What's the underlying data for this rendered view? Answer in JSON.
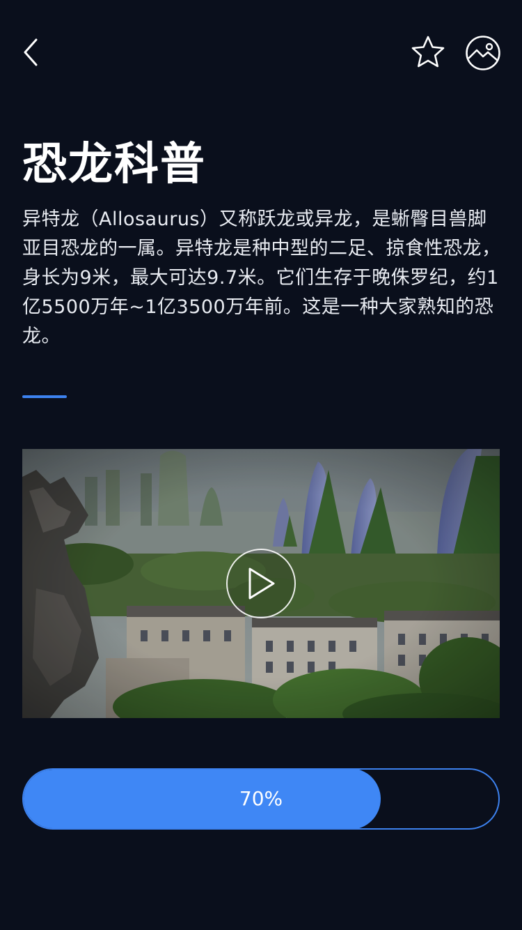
{
  "header": {
    "back_icon": "chevron-left-icon",
    "favorite_icon": "star-icon",
    "gallery_icon": "image-icon"
  },
  "article": {
    "title": "恐龙科普",
    "description": "异特龙（Allosaurus）又称跃龙或异龙，是蜥臀目兽脚亚目恐龙的一属。异特龙是种中型的二足、掠食性恐龙，身长为9米，最大可达9.7米。它们生存于晚侏罗纪，约1亿5500万年~1亿3500万年前。这是一种大家熟知的恐龙。"
  },
  "video": {
    "play_icon": "play-icon"
  },
  "progress": {
    "label": "70%",
    "value": 0.75
  },
  "colors": {
    "background": "#0a0f1c",
    "accent": "#3d82ef",
    "progress_fill": "#3f87f5",
    "text": "#ffffff"
  }
}
